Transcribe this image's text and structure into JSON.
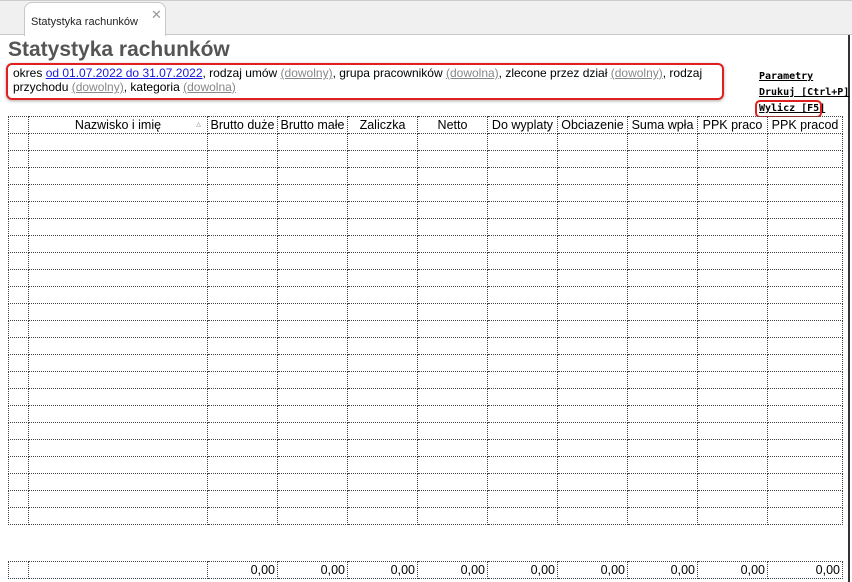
{
  "tab": {
    "label": "Statystyka rachunków",
    "close": "✕"
  },
  "title": "Statystyka rachunków",
  "filter": {
    "okres_label": "okres ",
    "okres_value": "od 01.07.2022 do 31.07.2022",
    "rodzaj_label": ", rodzaj umów ",
    "rodzaj_value": "(dowolny)",
    "grupa_label": ", grupa pracowników ",
    "grupa_value": "(dowolna)",
    "dzial_label": ", zlecone przez dział ",
    "dzial_value": "(dowolny)",
    "przychod_label": ", rodzaj przychodu ",
    "przychod_value": "(dowolny)",
    "kategoria_label": ", kategoria ",
    "kategoria_value": "(dowolna)"
  },
  "actions": {
    "parametry": "Parametry",
    "drukuj": "Drukuj [Ctrl+P]",
    "wylicz": "Wylicz [F5]"
  },
  "columns": [
    "",
    "Nazwisko i imię",
    "Brutto duże",
    "Brutto małe",
    "Zaliczka",
    "Netto",
    "Do wyplaty",
    "Obciazenie",
    "Suma wpła",
    "PPK praco",
    "PPK pracod"
  ],
  "sort_indicator": "▵",
  "totals": [
    "",
    "",
    "0,00",
    "0,00",
    "0,00",
    "0,00",
    "0,00",
    "0,00",
    "0,00",
    "0,00",
    "0,00"
  ]
}
